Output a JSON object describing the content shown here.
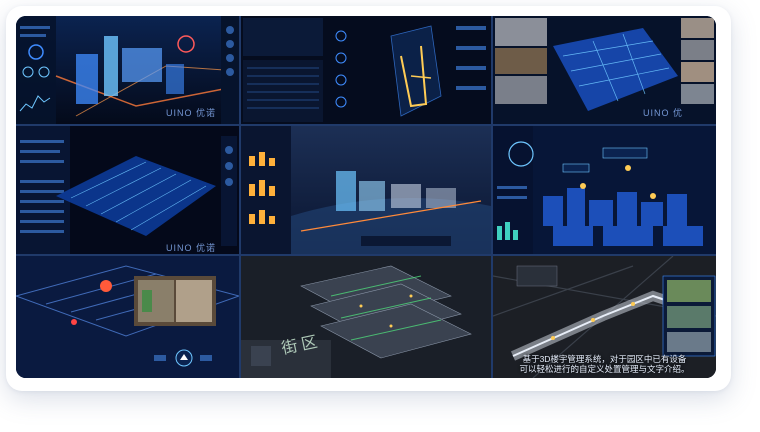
{
  "gallery": {
    "tiles": [
      {
        "name": "digital-twin-city-dashboard",
        "watermark": "UINO 优诺"
      },
      {
        "name": "building-monitoring-dashboard"
      },
      {
        "name": "indoor-floor-twin",
        "watermark": "UINO 优"
      },
      {
        "name": "park-operations-dashboard",
        "watermark": "UINO 优诺"
      },
      {
        "name": "waterfront-city-scene"
      },
      {
        "name": "urban-district-night-view"
      },
      {
        "name": "indoor-navigation-scene"
      },
      {
        "name": "district-model-scene",
        "watermark": "街区"
      },
      {
        "name": "underground-corridor-scene",
        "caption": "基于3D楼宇管理系统，对于园区中已有设备",
        "caption2": "可以轻松进行的自定义处置管理与文字介绍。"
      }
    ]
  },
  "colors": {
    "accent": "#3f8cff",
    "glow": "#6ec6ff",
    "panel": "#07122a",
    "warm": "#ffcc55"
  }
}
